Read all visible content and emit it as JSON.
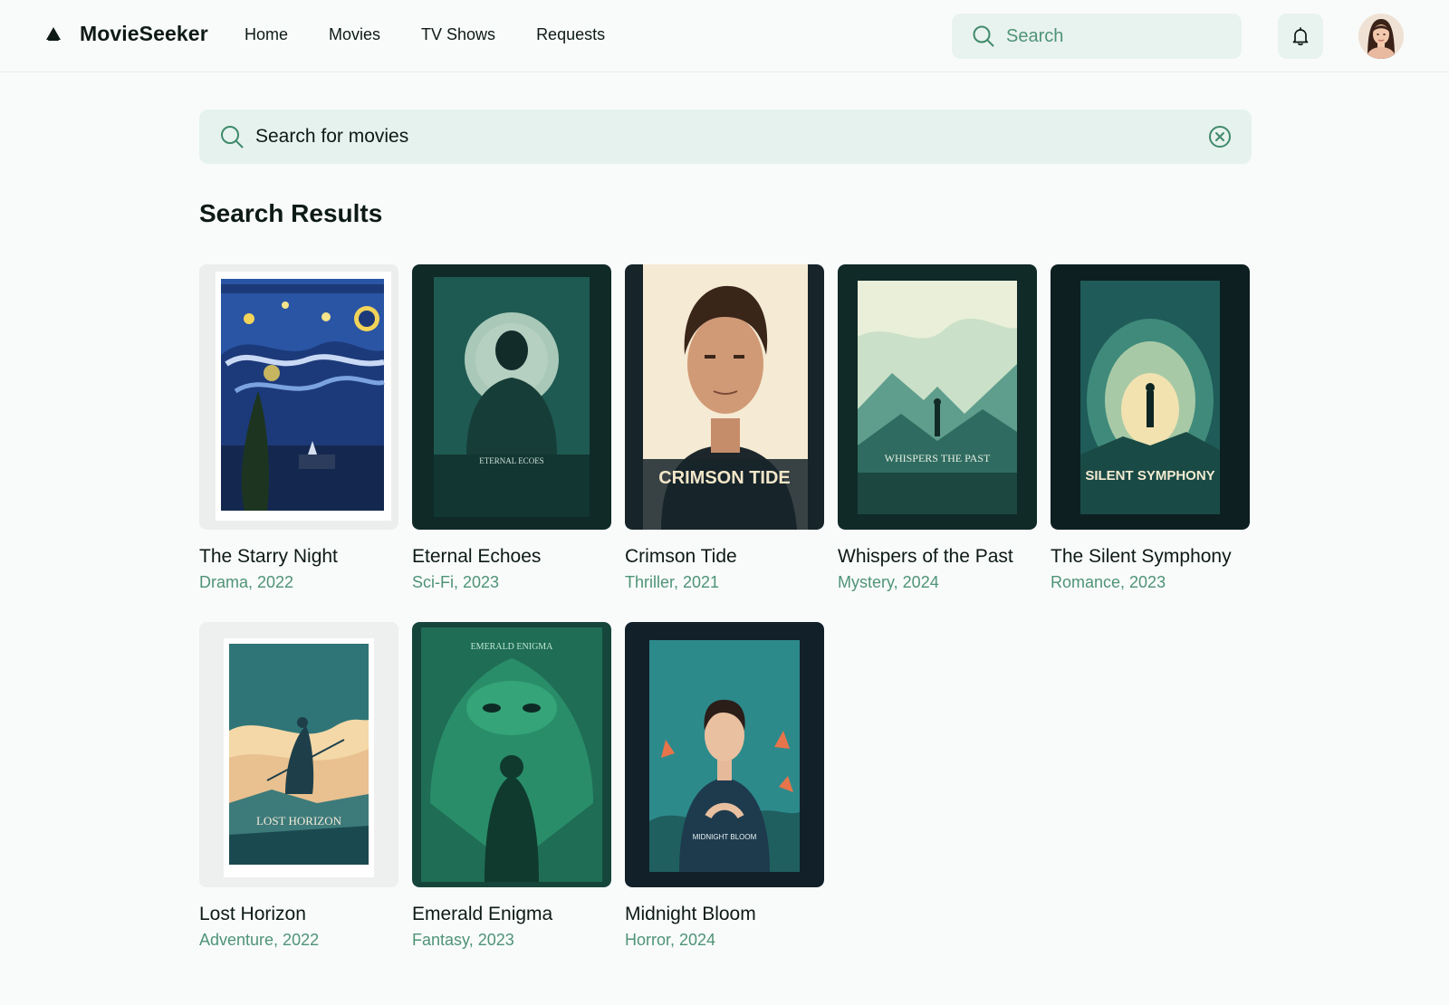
{
  "app": {
    "name": "MovieSeeker",
    "nav": [
      "Home",
      "Movies",
      "TV Shows",
      "Requests"
    ]
  },
  "header": {
    "search_placeholder": "Search",
    "icons": [
      "logo-icon",
      "search-icon",
      "bell-icon",
      "avatar"
    ]
  },
  "search": {
    "value": "Search for movies",
    "icons": [
      "search-icon",
      "clear-icon"
    ]
  },
  "results": {
    "title": "Search Results",
    "movies": [
      {
        "title": "The Starry Night",
        "meta": "Drama, 2022",
        "poster_text": ""
      },
      {
        "title": "Eternal Echoes",
        "meta": "Sci-Fi, 2023",
        "poster_text": "ETERNAL ECOES"
      },
      {
        "title": "Crimson Tide",
        "meta": "Thriller, 2021",
        "poster_text": "CRIMSON TIDE"
      },
      {
        "title": "Whispers of the Past",
        "meta": "Mystery, 2024",
        "poster_text": "WHISPERS THE PAST"
      },
      {
        "title": "The Silent Symphony",
        "meta": "Romance, 2023",
        "poster_text": "SILENT SYMPHONY"
      },
      {
        "title": "Lost Horizon",
        "meta": "Adventure, 2022",
        "poster_text": "LOST HORIZON"
      },
      {
        "title": "Emerald Enigma",
        "meta": "Fantasy, 2023",
        "poster_text": "EMERALD ENIGMA"
      },
      {
        "title": "Midnight Bloom",
        "meta": "Horror, 2024",
        "poster_text": "MIDNIGHT BLOOM"
      }
    ]
  },
  "colors": {
    "accent": "#4f9377",
    "search_bg": "#e6f2ed",
    "background": "#f8fbfa",
    "text": "#0e1a15"
  }
}
